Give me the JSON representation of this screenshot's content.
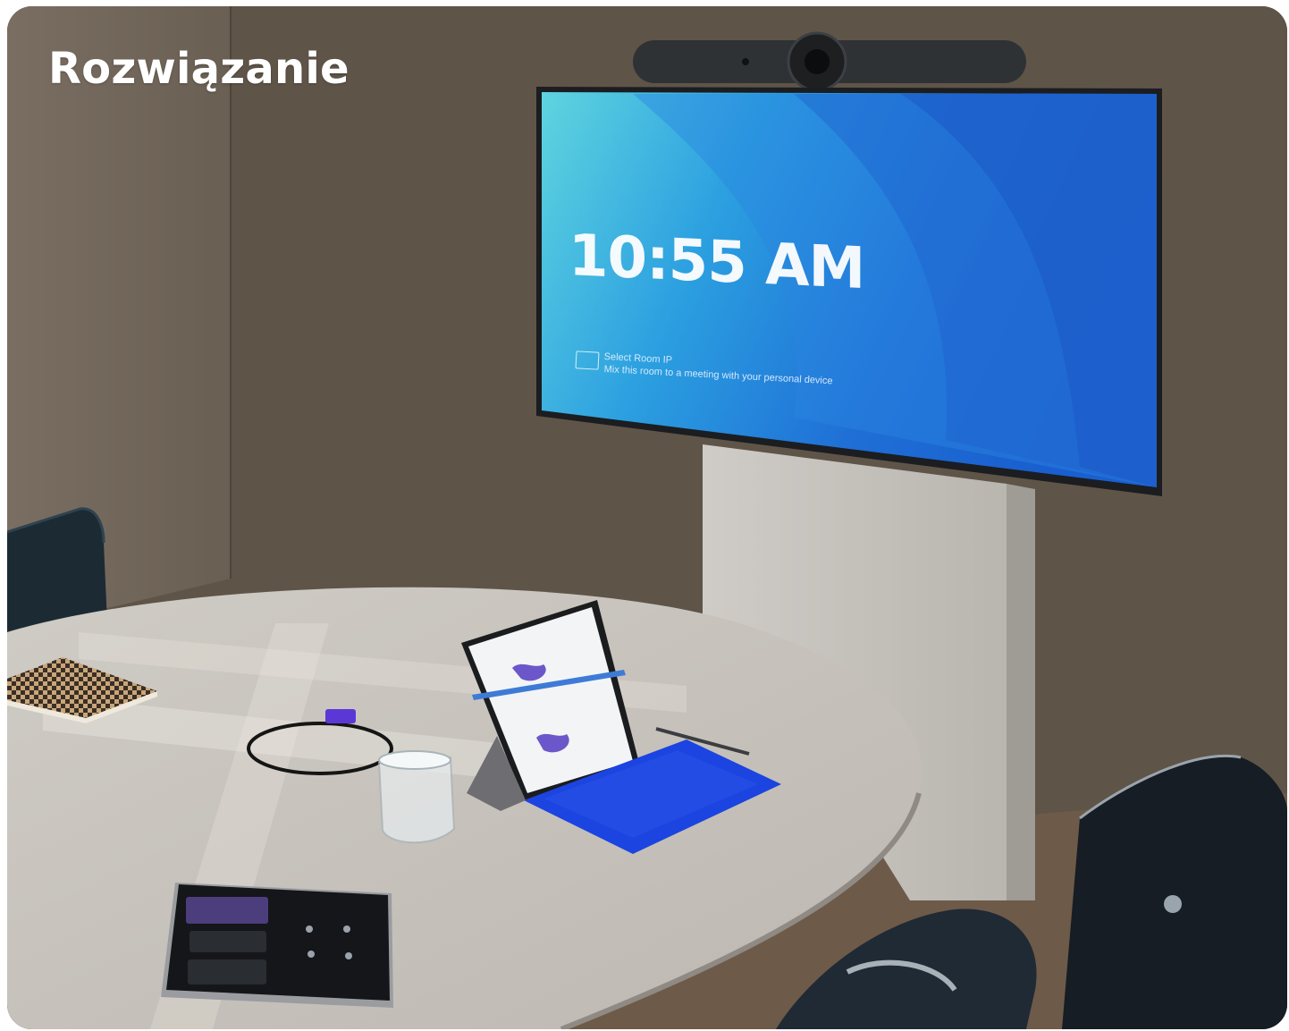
{
  "heading": "Rozwiązanie",
  "display": {
    "clock": "10:55 AM",
    "cast_title": "Select Room IP",
    "cast_subtitle": "Mix this room to a meeting with your personal device"
  },
  "icons": {
    "camera": "video-bar-camera-icon",
    "cast": "cast-screen-icon"
  },
  "colors": {
    "title_text": "#ffffff",
    "wall": "#5d5247",
    "screen_blue": "#1f6fd6",
    "keyboard_blue": "#1b44e0",
    "table": "#d9d6d1"
  }
}
